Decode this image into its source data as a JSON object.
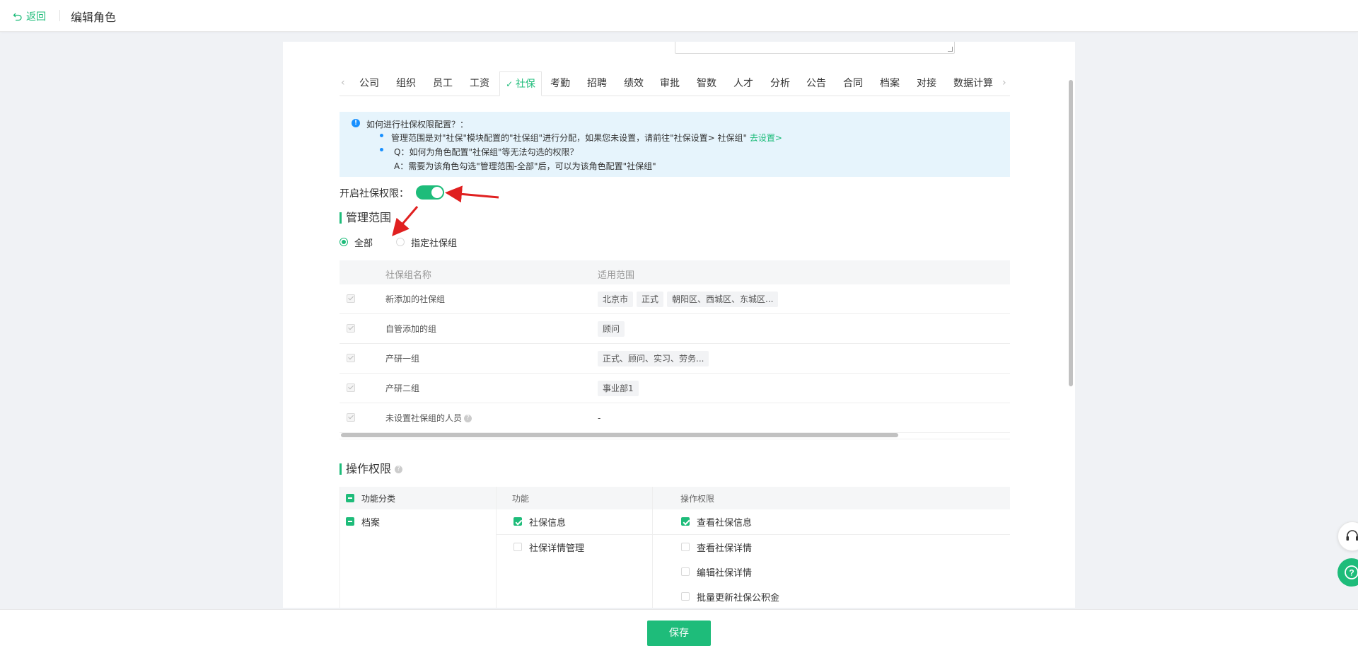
{
  "header": {
    "back_label": "返回",
    "title": "编辑角色"
  },
  "tabs": {
    "items": [
      "公司",
      "组织",
      "员工",
      "工资",
      "社保",
      "考勤",
      "招聘",
      "绩效",
      "审批",
      "智数",
      "人才",
      "分析",
      "公告",
      "合同",
      "档案",
      "对接",
      "数据计算"
    ],
    "active": "社保"
  },
  "info": {
    "title": "如何进行社保权限配置？：",
    "line1": "管理范围是对\"社保\"模块配置的\"社保组\"进行分配，如果您未设置，请前往\"社保设置> 社保组\" ",
    "line1_link": "去设置>",
    "line2": "Q：如何为角色配置\"社保组\"等无法勾选的权限？",
    "line3": "A：需要为该角色勾选\"管理范围-全部\"后，可以为该角色配置\"社保组\""
  },
  "toggle": {
    "label": "开启社保权限：",
    "enabled": true
  },
  "scope": {
    "title": "管理范围",
    "option_all": "全部",
    "option_specific": "指定社保组",
    "selected": "全部"
  },
  "groups": {
    "col_name": "社保组名称",
    "col_scope": "适用范围",
    "rows": [
      {
        "name": "新添加的社保组",
        "tags": [
          "北京市",
          "正式",
          "朝阳区、西城区、东城区..."
        ]
      },
      {
        "name": "自管添加的组",
        "tags": [
          "顾问"
        ]
      },
      {
        "name": "产研一组",
        "tags": [
          "正式、顾问、实习、劳务..."
        ]
      },
      {
        "name": "产研二组",
        "tags": [
          "事业部1"
        ]
      },
      {
        "name": "未设置社保组的人员",
        "tags": [],
        "empty": "-"
      }
    ]
  },
  "permissions": {
    "title": "操作权限",
    "col_category": "功能分类",
    "col_function": "功能",
    "col_ops": "操作权限",
    "category": "档案",
    "func1": "社保信息",
    "func2": "社保详情管理",
    "op1": "查看社保信息",
    "op2": "查看社保详情",
    "op3": "编辑社保详情",
    "op4": "批量更新社保公积金"
  },
  "footer": {
    "save_label": "保存"
  },
  "colors": {
    "accent": "#1ebc7a",
    "info_bg": "#e6f4fc",
    "annotation": "#e02020"
  }
}
